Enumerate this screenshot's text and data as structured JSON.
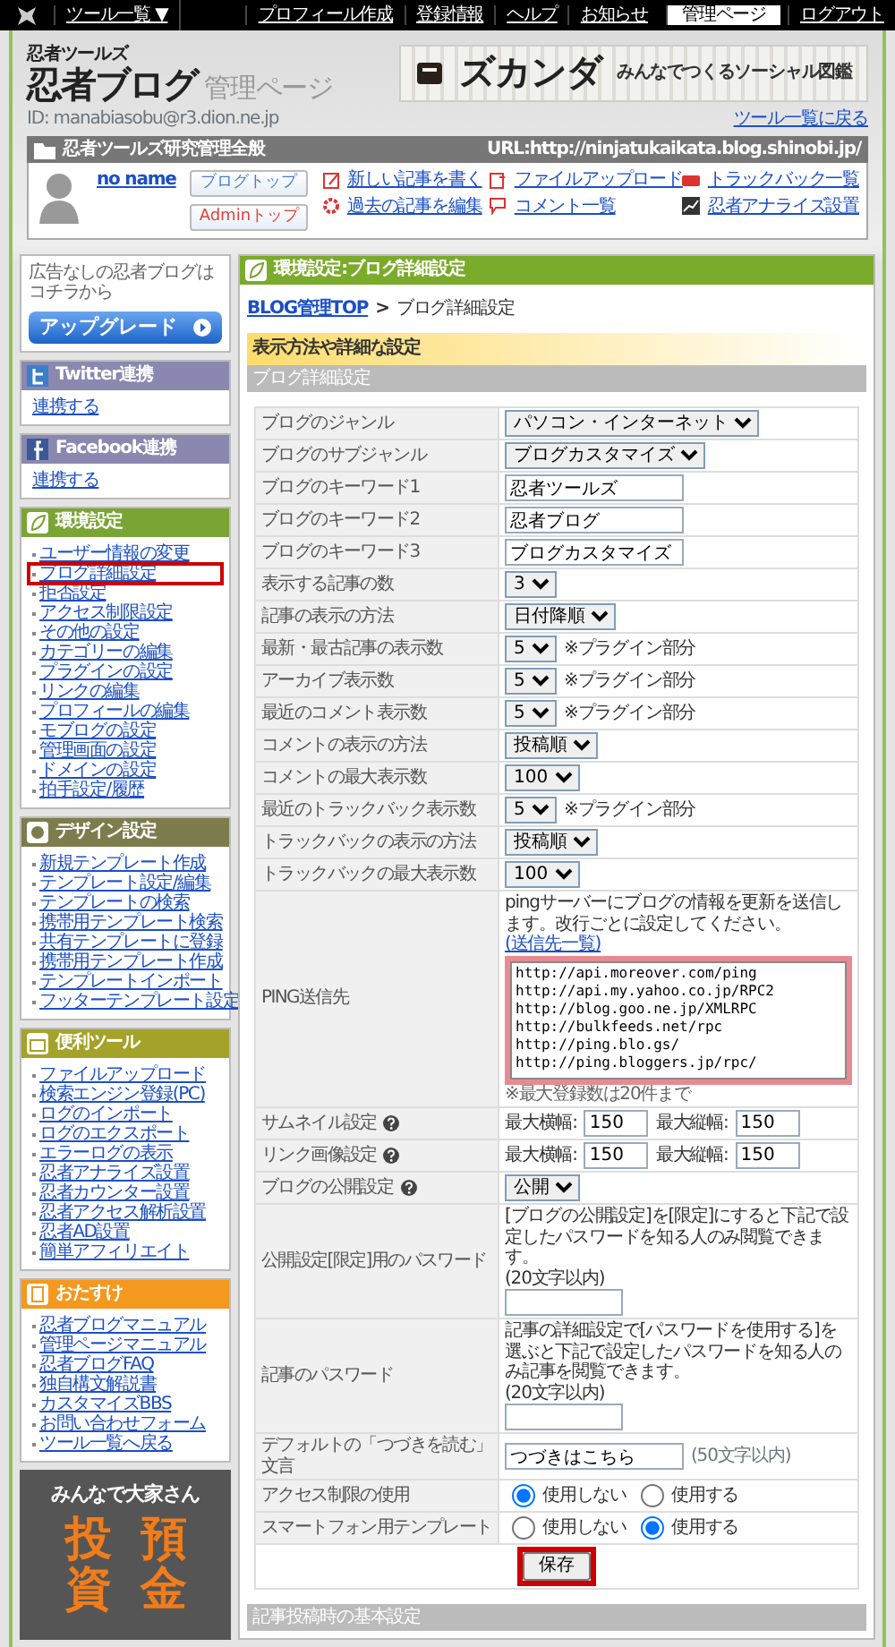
{
  "top_bar": {
    "menu": "ツール一覧 ▼",
    "links": [
      {
        "label": "プロフィール作成",
        "selected": false
      },
      {
        "label": "登録情報",
        "selected": false
      },
      {
        "label": "ヘルプ",
        "selected": false
      },
      {
        "label": "お知らせ",
        "selected": false
      },
      {
        "label": "管理ページ",
        "selected": true
      },
      {
        "label": "ログアウト",
        "selected": false
      }
    ]
  },
  "header": {
    "brand_small": "忍者ツールズ",
    "brand": "忍者ブログ",
    "brand_sub": "管理ページ",
    "banner": {
      "logo": "ズカンダ",
      "tagline": "みんなでつくるソーシャル図鑑"
    },
    "user_id": "ID: manabiasobu@r3.dion.ne.jp",
    "back_link": "ツール一覧に戻る"
  },
  "blog_bar": {
    "title": "忍者ツールズ研究管理全般",
    "url": "URL:http://ninjatukaikata.blog.shinobi.jp/"
  },
  "quick": {
    "user_name": "no name",
    "buttons": [
      {
        "label": "ブログトップ",
        "color": "#4a7fd0"
      },
      {
        "label": "Adminトップ",
        "color": "#e0413a"
      }
    ],
    "links": [
      {
        "label": "新しい記事を書く",
        "kind": "write"
      },
      {
        "label": "過去の記事を編集",
        "kind": "edit"
      },
      {
        "label": "ファイルアップロード",
        "kind": "upload"
      },
      {
        "label": "コメント一覧",
        "kind": "comment"
      },
      {
        "label": "トラックバック一覧",
        "kind": "trackback"
      },
      {
        "label": "忍者アナライズ設置",
        "kind": "analytics"
      }
    ]
  },
  "sidebar": {
    "upgrade": {
      "note": "広告なしの忍者ブログはコチラから",
      "button": "アップグレード"
    },
    "sections": [
      {
        "title": "Twitter連携",
        "kind": "twitter",
        "color": "#8a88b0",
        "items": [
          {
            "label": "連携する",
            "highlighted": false
          }
        ]
      },
      {
        "title": "Facebook連携",
        "kind": "facebook",
        "color": "#8a88b0",
        "items": [
          {
            "label": "連携する",
            "highlighted": false
          }
        ]
      },
      {
        "title": "環境設定",
        "kind": "settings",
        "color": "#7aa534",
        "items": [
          {
            "label": "ユーザー情報の変更",
            "highlighted": false
          },
          {
            "label": "ブログ詳細設定",
            "highlighted": true
          },
          {
            "label": "拒否設定",
            "highlighted": false
          },
          {
            "label": "アクセス制限設定",
            "highlighted": false
          },
          {
            "label": "その他の設定",
            "highlighted": false
          },
          {
            "label": "カテゴリーの編集",
            "highlighted": false
          },
          {
            "label": "プラグインの設定",
            "highlighted": false
          },
          {
            "label": "リンクの編集",
            "highlighted": false
          },
          {
            "label": "プロフィールの編集",
            "highlighted": false
          },
          {
            "label": "モブログの設定",
            "highlighted": false
          },
          {
            "label": "管理画面の設定",
            "highlighted": false
          },
          {
            "label": "ドメインの設定",
            "highlighted": false
          },
          {
            "label": "拍手設定/履歴",
            "highlighted": false
          }
        ]
      },
      {
        "title": "デザイン設定",
        "kind": "design",
        "color": "#7d7c4c",
        "items": [
          {
            "label": "新規テンプレート作成",
            "highlighted": false
          },
          {
            "label": "テンプレート設定/編集",
            "highlighted": false
          },
          {
            "label": "テンプレートの検索",
            "highlighted": false
          },
          {
            "label": "携帯用テンプレート検索",
            "highlighted": false
          },
          {
            "label": "共有テンプレートに登録",
            "highlighted": false
          },
          {
            "label": "携帯用テンプレート作成",
            "highlighted": false
          },
          {
            "label": "テンプレートインポート",
            "highlighted": false
          },
          {
            "label": "フッターテンプレート設定",
            "highlighted": false
          }
        ]
      },
      {
        "title": "便利ツール",
        "kind": "tools",
        "color": "#a5a22a",
        "items": [
          {
            "label": "ファイルアップロード",
            "highlighted": false
          },
          {
            "label": "検索エンジン登録(PC)",
            "highlighted": false
          },
          {
            "label": "ログのインポート",
            "highlighted": false
          },
          {
            "label": "ログのエクスポート",
            "highlighted": false
          },
          {
            "label": "エラーログの表示",
            "highlighted": false
          },
          {
            "label": "忍者アナライズ設置",
            "highlighted": false
          },
          {
            "label": "忍者カウンター設置",
            "highlighted": false
          },
          {
            "label": "忍者アクセス解析設置",
            "highlighted": false
          },
          {
            "label": "忍者AD設置",
            "highlighted": false
          },
          {
            "label": "簡単アフィリエイト",
            "highlighted": false
          }
        ]
      },
      {
        "title": "おたすけ",
        "kind": "help",
        "color": "#f5981e",
        "items": [
          {
            "label": "忍者ブログマニュアル",
            "highlighted": false
          },
          {
            "label": "管理ページマニュアル",
            "highlighted": false
          },
          {
            "label": "忍者ブログFAQ",
            "highlighted": false
          },
          {
            "label": "独自構文解説書",
            "highlighted": false
          },
          {
            "label": "カスタマイズBBS",
            "highlighted": false
          },
          {
            "label": "お問い合わせフォーム",
            "highlighted": false
          },
          {
            "label": "ツール一覧へ戻る",
            "highlighted": false
          }
        ]
      }
    ],
    "ad": {
      "headline": "みんなで大家さん",
      "columns": [
        "投資",
        "預金"
      ]
    }
  },
  "main": {
    "title": "環境設定:ブログ詳細設定",
    "breadcrumb": {
      "link": "BLOG管理TOP",
      "separator": ">",
      "current": "ブログ詳細設定"
    },
    "section_title": "表示方法や詳細な設定",
    "subsection": "ブログ詳細設定",
    "rows": [
      {
        "label": "ブログのジャンル",
        "kind": "select",
        "value": "パソコン・インターネット"
      },
      {
        "label": "ブログのサブジャンル",
        "kind": "select",
        "value": "ブログカスタマイズ"
      },
      {
        "label": "ブログのキーワード1",
        "kind": "text",
        "value": "忍者ツールズ"
      },
      {
        "label": "ブログのキーワード2",
        "kind": "text",
        "value": "忍者ブログ"
      },
      {
        "label": "ブログのキーワード3",
        "kind": "text",
        "value": "ブログカスタマイズ"
      },
      {
        "label": "表示する記事の数",
        "kind": "select",
        "value": "3"
      },
      {
        "label": "記事の表示の方法",
        "kind": "select",
        "value": "日付降順"
      },
      {
        "label": "最新・最古記事の表示数",
        "kind": "select",
        "value": "5",
        "note": "※プラグイン部分"
      },
      {
        "label": "アーカイブ表示数",
        "kind": "select",
        "value": "5",
        "note": "※プラグイン部分"
      },
      {
        "label": "最近のコメント表示数",
        "kind": "select",
        "value": "5",
        "note": "※プラグイン部分"
      },
      {
        "label": "コメントの表示の方法",
        "kind": "select",
        "value": "投稿順"
      },
      {
        "label": "コメントの最大表示数",
        "kind": "select",
        "value": "100"
      },
      {
        "label": "最近のトラックバック表示数",
        "kind": "select",
        "value": "5",
        "note": "※プラグイン部分"
      },
      {
        "label": "トラックバックの表示の方法",
        "kind": "select",
        "value": "投稿順"
      },
      {
        "label": "トラックバックの最大表示数",
        "kind": "select",
        "value": "100"
      },
      {
        "label": "PING送信先",
        "kind": "textarea",
        "description": "pingサーバーにブログの情報を更新を送信します。改行ごとに設定してください。",
        "link": "(送信先一覧)",
        "lines": [
          "http://api.moreover.com/ping",
          "http://api.my.yahoo.co.jp/RPC2",
          "http://blog.goo.ne.jp/XMLRPC",
          "http://bulkfeeds.net/rpc",
          "http://ping.blo.gs/",
          "http://ping.bloggers.jp/rpc/"
        ],
        "note": "※最大登録数は20件まで",
        "highlighted": true
      },
      {
        "label": "サムネイル設定",
        "help": true,
        "kind": "size",
        "fields": [
          {
            "label": "最大横幅:",
            "value": "150"
          },
          {
            "label": "最大縦幅:",
            "value": "150"
          }
        ]
      },
      {
        "label": "リンク画像設定",
        "help": true,
        "kind": "size",
        "fields": [
          {
            "label": "最大横幅:",
            "value": "150"
          },
          {
            "label": "最大縦幅:",
            "value": "150"
          }
        ]
      },
      {
        "label": "ブログの公開設定",
        "help": true,
        "kind": "select",
        "value": "公開"
      },
      {
        "label": "公開設定[限定]用のパスワード",
        "kind": "password",
        "description": "[ブログの公開設定]を[限定]にすると下記で設定したパスワードを知る人のみ閲覧できます。",
        "limit": "(20文字以内)"
      },
      {
        "label": "記事のパスワード",
        "kind": "password",
        "description": "記事の詳細設定で[パスワードを使用する]を選ぶと下記で設定したパスワードを知る人のみ記事を閲覧できます。",
        "limit": "(20文字以内)"
      },
      {
        "label": "デフォルトの「つづきを読む」文言",
        "kind": "text",
        "value": "つづきはこちら",
        "note": "(50文字以内)"
      },
      {
        "label": "アクセス制限の使用",
        "kind": "radio",
        "options": [
          {
            "label": "使用しない",
            "selected": true
          },
          {
            "label": "使用する",
            "selected": false
          }
        ]
      },
      {
        "label": "スマートフォン用テンプレート",
        "kind": "radio",
        "options": [
          {
            "label": "使用しない",
            "selected": false
          },
          {
            "label": "使用する",
            "selected": true
          }
        ]
      }
    ],
    "save": {
      "label": "保存",
      "highlighted": true
    },
    "next_section": "記事投稿時の基本設定"
  }
}
